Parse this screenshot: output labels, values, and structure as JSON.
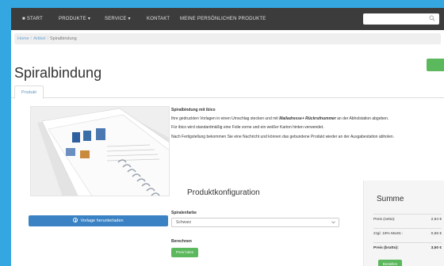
{
  "nav": {
    "items": [
      "START",
      "PRODUKTE",
      "SERVICE",
      "KONTAKT",
      "MEINE PERSÖNLICHEN PRODUKTE"
    ],
    "search_placeholder": ""
  },
  "breadcrumb": [
    "Home",
    "Artikel",
    "Spiralbindung"
  ],
  "page_title": "Spiralbindung",
  "tabs": [
    "Produkt"
  ],
  "description": {
    "title": "Spiralbindung mit ibico",
    "line1_a": "Ihre gedruckten Vorlagen in einen Umschlag stecken und mit ",
    "line1_b": "Mailadresse+ Rückrufnummer",
    "line1_c": " an der Abholstation abgeben.",
    "para2": "Für ibico wird standardmäßig eine Folie vorne und ein weißer Karton hinten verwendet.",
    "para3": "Nach Fertigstellung bekommen Sie eine Nachricht und können das gebundene Produkt wieder an der Ausgabestation abholen."
  },
  "download_label": "Vorlage herunterladen",
  "config": {
    "heading": "Produktkonfiguration",
    "color_label": "Spiralenfarbe",
    "color_value": "Schwarz",
    "calc_label": "Berechnen",
    "calc_button": "Preis holen"
  },
  "summary": {
    "title": "Summe",
    "rows": [
      {
        "label": "Preis (netto):",
        "value": "2,94 €"
      },
      {
        "label": "zzgl. 19% MwSt.:",
        "value": "0,56 €"
      },
      {
        "label": "Preis (brutto):",
        "value": "3,50 €"
      }
    ],
    "order_button": "Bestellen"
  },
  "colors": {
    "frame": "#35a7e0",
    "navbar": "#3c3c3c",
    "primary": "#3a82c4",
    "success": "#5cb85c"
  }
}
